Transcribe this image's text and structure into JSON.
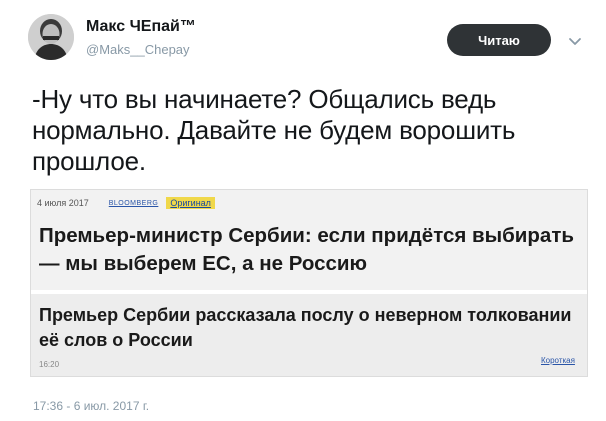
{
  "author": {
    "name": "Макс ЧЕпай™",
    "handle": "@Maks__Chepay"
  },
  "follow_button": {
    "label": "Читаю"
  },
  "tweet": {
    "text": "-Ну что вы начинаете? Общались ведь нормально. Давайте не будем ворошить прошлое.",
    "timestamp": "17:36 - 6 июл. 2017 г."
  },
  "card": {
    "date": "4 июля 2017",
    "source": "BLOOMBERG",
    "original_label": "Оригинал",
    "headline_1": "Премьер-министр Сербии: если придётся выбирать — мы выберем ЕС, а не Россию",
    "headline_2": "Премьер Сербии рассказала послу о неверном толковании её слов о России",
    "time": "16:20",
    "short_label": "Короткая"
  },
  "icons": {
    "avatar": "avatar-portrait",
    "caret": "chevron-down-icon"
  },
  "colors": {
    "follow_button_bg": "#2f3336",
    "handle_text": "#8899a6",
    "original_badge_bg": "#f0d84a",
    "link": "#2a55a8"
  }
}
